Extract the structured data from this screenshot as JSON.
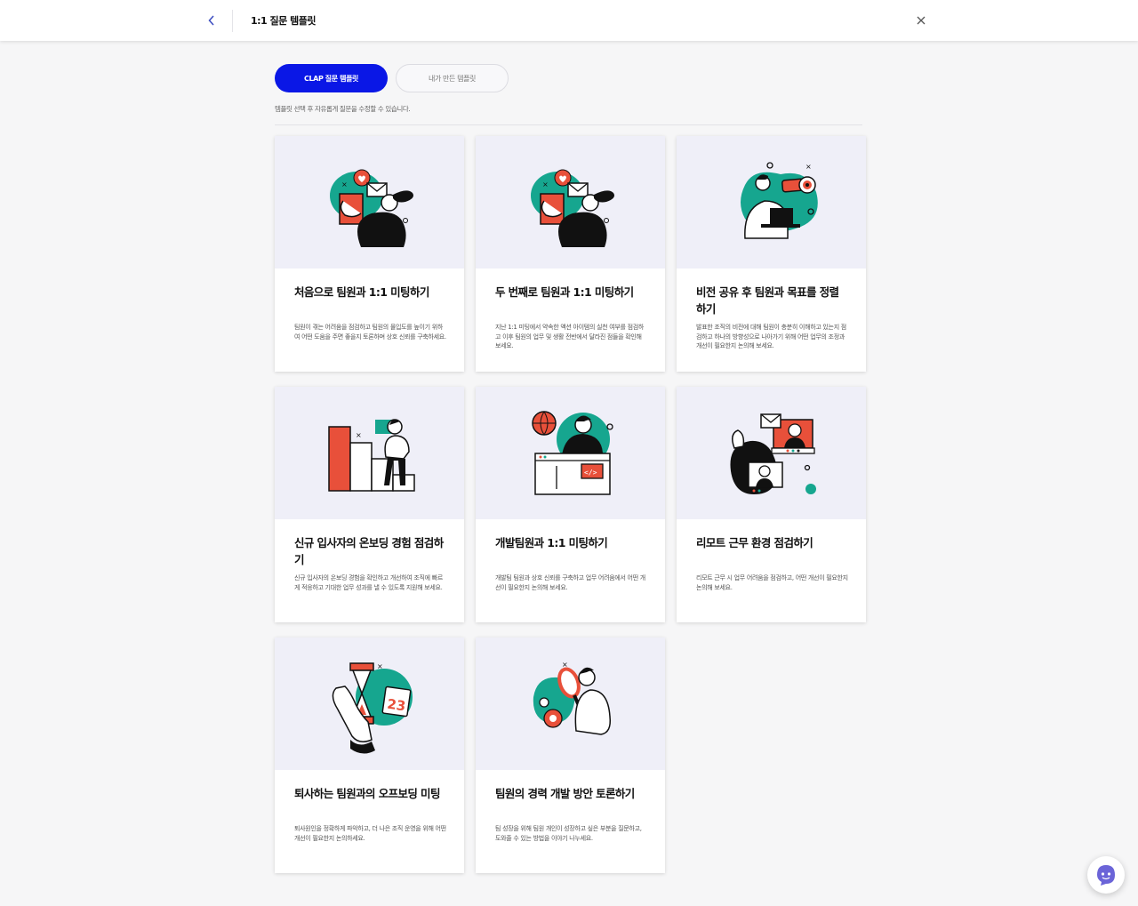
{
  "header": {
    "title": "1:1 질문 템플릿",
    "back_icon": "chevron-left-icon",
    "close_icon": "close-icon"
  },
  "tabs": [
    {
      "label": "CLAP 질문 템플릿",
      "active": true
    },
    {
      "label": "내가 만든 템플릿",
      "active": false
    }
  ],
  "hint": "템플릿 선택 후 자유롭게 질문을 수정할 수 있습니다.",
  "colors": {
    "accent": "#0a17e6",
    "teal": "#16a68f",
    "red": "#e8503a",
    "illustration_bg": "#efeff8"
  },
  "cards": [
    {
      "title": "처음으로 팀원과 1:1 미팅하기",
      "description": "팀원이 겪는 어려움을 점검하고 팀원의 몰입도를 높이기 위하여 어떤 도움을 주면 좋을지 토론하며 상호 신뢰를 구축하세요.",
      "illustration": "heart-mail-illustration"
    },
    {
      "title": "두 번째로 팀원과 1:1 미팅하기",
      "description": "지난 1:1 미팅에서 약속한 액션 아이템의 실천 여부를 점검하고 이후 팀원의 업무 및 생활 전반에서 달라진 점들을 확인해 보세요.",
      "illustration": "heart-mail-illustration"
    },
    {
      "title": "비전 공유 후 팀원과 목표를 정렬하기",
      "description": "발표한 조직의 비전에 대해 팀원이 충분히 이해하고 있는지 점검하고 하나의 방향성으로 나아가기 위해 어떤 업무의 조정과 개선이 필요한지 논의해 보세요.",
      "illustration": "telescope-illustration"
    },
    {
      "title": "신규 입사자의 온보딩 경험 점검하기",
      "description": "신규 입사자의 온보딩 경험을 확인하고 개선하여 조직에 빠르게 적응하고 기대한 업무 성과를 낼 수 있도록 지원해 보세요.",
      "illustration": "stairs-illustration"
    },
    {
      "title": "개발팀원과 1:1 미팅하기",
      "description": "개발팀 팀원과 상호 신뢰를 구축하고 업무 어려움에서 어떤 개선이 필요한지 논의해 보세요.",
      "illustration": "developer-illustration"
    },
    {
      "title": "리모트 근무 환경 점검하기",
      "description": "리모트 근무 시 업무 어려움을 점검하고, 어떤 개선이 필요한지 논의해 보세요.",
      "illustration": "video-call-illustration"
    },
    {
      "title": "퇴사하는 팀원과의 오프보딩 미팅",
      "description": "퇴사원인을 정확하게 파악하고, 더 나은 조직 운영을 위해 어떤 개선이 필요한지 논의하세요.",
      "illustration": "hourglass-calendar-illustration"
    },
    {
      "title": "팀원의 경력 개발 방안 토론하기",
      "description": "팀 성장을 위해 팀원 개인이 성장하고 싶은 부분을 질문하고, 도와줄 수 있는 방법을 이야기 나누세요.",
      "illustration": "magnifier-illustration"
    }
  ],
  "calendar_day": "23",
  "chat_fab_icon": "chat-bot-icon"
}
